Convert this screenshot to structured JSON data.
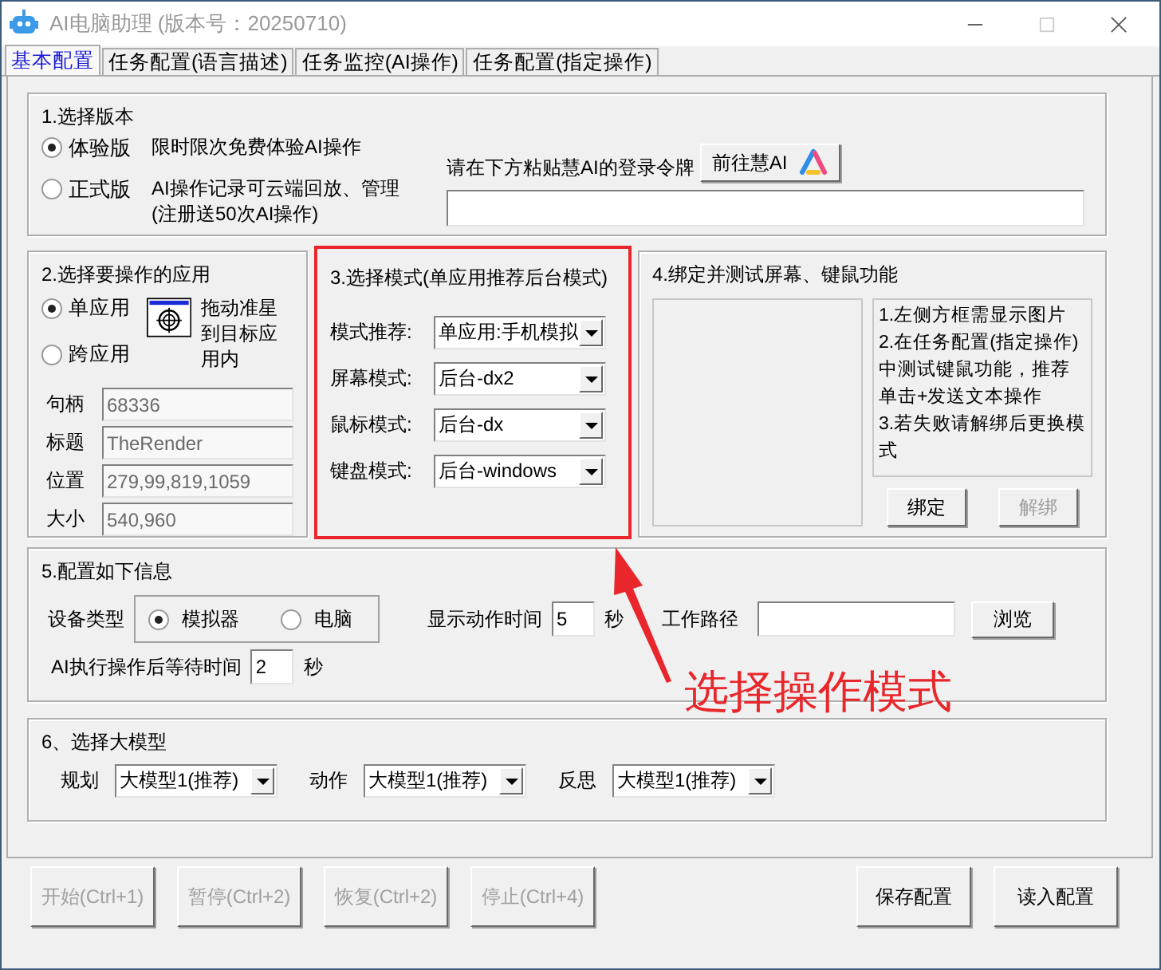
{
  "window": {
    "title": "AI电脑助理 (版本号：20250710)"
  },
  "tabs": [
    {
      "label": "基本配置",
      "selected": true
    },
    {
      "label": "任务配置(语言描述)",
      "selected": false
    },
    {
      "label": "任务监控(AI操作)",
      "selected": false
    },
    {
      "label": "任务配置(指定操作)",
      "selected": false
    }
  ],
  "version_section": {
    "title": "1.选择版本",
    "options": [
      {
        "label": "体验版",
        "description": "限时限次免费体验AI操作",
        "selected": true
      },
      {
        "label": "正式版",
        "description": "AI操作记录可云端回放、管理(注册送50次AI操作)",
        "selected": false
      }
    ],
    "token_label": "请在下方粘贴慧AI的登录令牌",
    "token_button": "前往慧AI"
  },
  "app_section": {
    "title": "2.选择要操作的应用",
    "options": [
      {
        "label": "单应用",
        "selected": true
      },
      {
        "label": "跨应用",
        "selected": false
      }
    ],
    "drag_hint": "拖动准星到目标应用内",
    "fields": [
      {
        "label": "句柄",
        "value": "68336",
        "disabled": true
      },
      {
        "label": "标题",
        "value": "TheRender",
        "disabled": true
      },
      {
        "label": "位置",
        "value": "279,99,819,1059",
        "disabled": true
      },
      {
        "label": "大小",
        "value": "540,960",
        "disabled": true
      }
    ]
  },
  "mode_section": {
    "title": "3.选择模式(单应用推荐后台模式)",
    "highlighted": true,
    "selects": [
      {
        "label": "模式推荐:",
        "value": "单应用:手机模拟"
      },
      {
        "label": "屏幕模式:",
        "value": "后台-dx2"
      },
      {
        "label": "鼠标模式:",
        "value": "后台-dx"
      },
      {
        "label": "键盘模式:",
        "value": "后台-windows"
      }
    ]
  },
  "bind_section": {
    "title": "4.绑定并测试屏幕、键鼠功能",
    "notes": [
      "1.左侧方框需显示图片",
      "2.在任务配置(指定操作)中测试键鼠功能，推荐单击+发送文本操作",
      "3.若失败请解绑后更换模式"
    ],
    "buttons": [
      {
        "label": "绑定",
        "disabled": false
      },
      {
        "label": "解绑",
        "disabled": true
      }
    ]
  },
  "config_section": {
    "title": "5.配置如下信息",
    "device_label": "设备类型",
    "device_options": [
      {
        "label": "模拟器",
        "selected": true
      },
      {
        "label": "电脑",
        "selected": false
      }
    ],
    "show_time_label": "显示动作时间",
    "show_time_value": "5",
    "show_time_unit": "秒",
    "path_label": "工作路径",
    "path_button": "浏览",
    "wait_label": "AI执行操作后等待时间",
    "wait_value": "2",
    "wait_unit": "秒"
  },
  "model_section": {
    "title": "6、选择大模型",
    "selects": [
      {
        "label": "规划",
        "value": "大模型1(推荐)"
      },
      {
        "label": "动作",
        "value": "大模型1(推荐)"
      },
      {
        "label": "反思",
        "value": "大模型1(推荐)"
      }
    ]
  },
  "footer_buttons": [
    {
      "label": "开始(Ctrl+1)",
      "disabled": true
    },
    {
      "label": "暂停(Ctrl+2)",
      "disabled": true
    },
    {
      "label": "恢复(Ctrl+2)",
      "disabled": true
    },
    {
      "label": "停止(Ctrl+4)",
      "disabled": true
    },
    {
      "label": "保存配置",
      "disabled": false
    },
    {
      "label": "读入配置",
      "disabled": false
    }
  ],
  "annotation": {
    "text": "选择操作模式"
  }
}
